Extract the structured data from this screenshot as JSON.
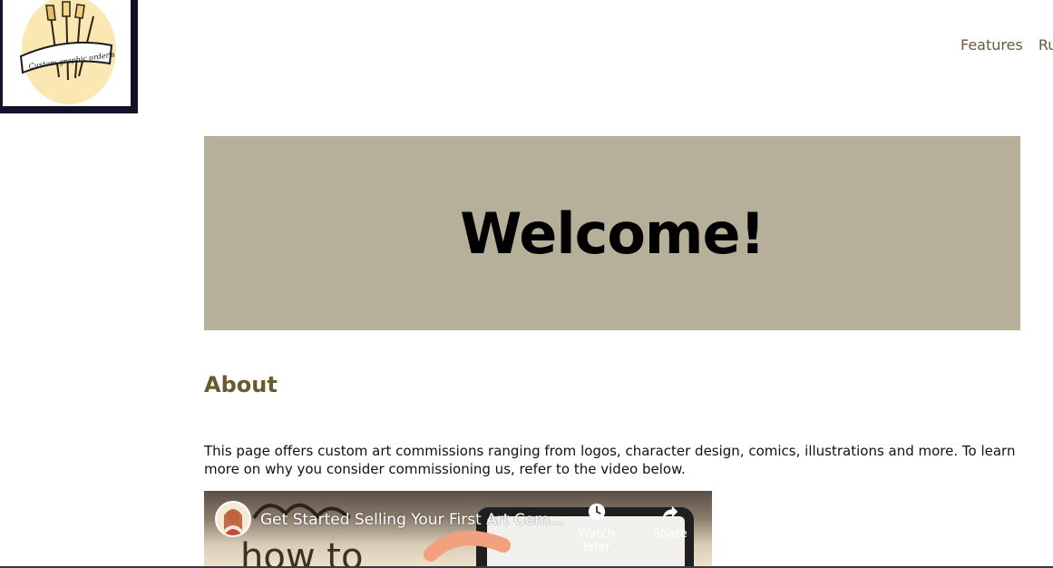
{
  "header": {
    "logo_text": "Custom graphic order's",
    "nav": [
      {
        "label": "Features"
      },
      {
        "label": "Rul"
      }
    ]
  },
  "hero": {
    "title": "Welcome!"
  },
  "about": {
    "title": "About",
    "text": "This page offers custom art commissions ranging from logos, character design, comics, illustrations and more. To learn more on why you consider commissioning us, refer to the video below."
  },
  "video": {
    "title": "Get Started Selling Your First Art Com...",
    "watch_later_label": "Watch later",
    "share_label": "Share",
    "thumbnail_text": "how to"
  },
  "colors": {
    "logo_border": "#12132a",
    "hero_bg": "#b6af99",
    "about_title": "#6b5a2e",
    "nav_text": "#6b5a3a"
  }
}
